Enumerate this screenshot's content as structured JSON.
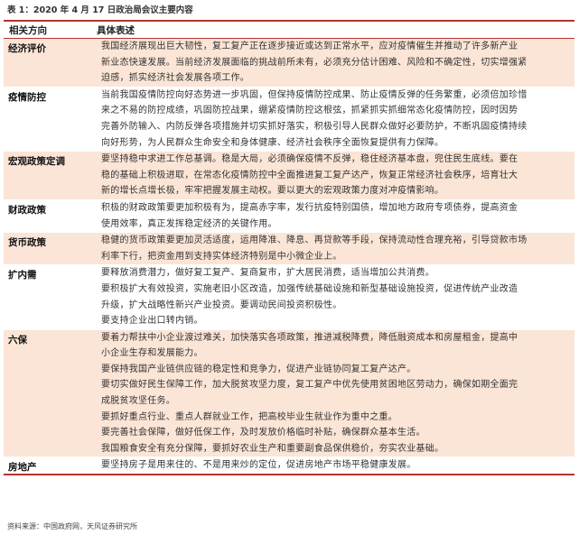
{
  "caption": "表 1：2020 年 4 月 17 日政治局会议主要内容",
  "header": {
    "direction": "相关方向",
    "content": "具体表述"
  },
  "rows": [
    {
      "category": "经济评价",
      "shaded": true,
      "lines": [
        "我国经济展现出巨大韧性，复工复产正在逐步接近或达到正常水平，应对疫情催生并推动了许多新产业",
        "新业态快速发展。当前经济发展面临的挑战前所未有，必须充分估计困难、风险和不确定性，切实增强紧",
        "迫感，抓实经济社会发展各项工作。"
      ]
    },
    {
      "category": "疫情防控",
      "shaded": false,
      "lines": [
        "当前我国疫情防控向好态势进一步巩固，但保持疫情防控成果、防止疫情反弹的任务繁重，必须倍加珍惜",
        "来之不易的防控成绩，巩固防控战果，绷紧疫情防控这根弦，抓紧抓实抓细常态化疫情防控，因时因势",
        "完善外防输入、内防反弹各项措施并切实抓好落实，积极引导人民群众做好必要防护，不断巩固疫情持续",
        "向好形势，为人民群众生命安全和身体健康、经济社会秩序全面恢复提供有力保障。"
      ]
    },
    {
      "category": "宏观政策定调",
      "shaded": true,
      "lines": [
        "要坚持稳中求进工作总基调。稳是大局，必须确保疫情不反弹，稳住经济基本盘，兜住民生底线。要在",
        "稳的基础上积极进取，在常态化疫情防控中全面推进复工复产达产，恢复正常经济社会秩序，培育壮大",
        "新的增长点增长极，牢牢把握发展主动权。要以更大的宏观政策力度对冲疫情影响。"
      ]
    },
    {
      "category": "财政政策",
      "shaded": false,
      "lines": [
        "积极的财政政策要更加积极有为，提高赤字率，发行抗疫特别国债，增加地方政府专项债券，提高资金",
        "使用效率，真正发挥稳定经济的关键作用。"
      ]
    },
    {
      "category": "货币政策",
      "shaded": true,
      "lines": [
        "稳健的货币政策要更加灵活适度，运用降准、降息、再贷款等手段，保持流动性合理充裕，引导贷款市场",
        "利率下行，把资金用到支持实体经济特别是中小微企业上。"
      ]
    },
    {
      "category": "扩内需",
      "shaded": false,
      "lines": [
        "要释放消费潜力，做好复工复产、复商复市，扩大居民消费，适当增加公共消费。",
        "要积极扩大有效投资，实施老旧小区改造，加强传统基础设施和新型基础设施投资，促进传统产业改造",
        "升级，扩大战略性新兴产业投资。要调动民间投资积极性。",
        "要支持企业出口转内销。"
      ]
    },
    {
      "category": "六保",
      "shaded": true,
      "lines": [
        "要着力帮扶中小企业渡过难关，加快落实各项政策，推进减税降费，降低融资成本和房屋租金，提高中",
        "小企业生存和发展能力。",
        "要保持我国产业链供应链的稳定性和竞争力，促进产业链协同复工复产达产。",
        "要切实做好民生保障工作，加大脱贫攻坚力度，复工复产中优先使用贫困地区劳动力，确保如期全面完",
        "成脱贫攻坚任务。",
        "要抓好重点行业、重点人群就业工作，把高校毕业生就业作为重中之重。",
        "要完善社会保障，做好低保工作，及时发放价格临时补贴，确保群众基本生活。",
        "我国粮食安全有充分保障，要抓好农业生产和重要副食品保供稳价，夯实农业基础。"
      ]
    },
    {
      "category": "房地产",
      "shaded": false,
      "lines": [
        "要坚持房子是用来住的、不是用来炒的定位，促进房地产市场平稳健康发展。"
      ]
    }
  ],
  "source": "资料来源：中国政府网，天风证券研究所"
}
